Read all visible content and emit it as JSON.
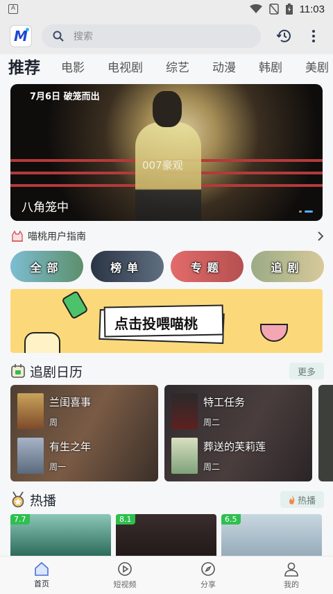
{
  "status_bar": {
    "time": "11:03"
  },
  "header": {
    "logo_letter": "M",
    "search_placeholder": "搜索"
  },
  "tabs": [
    "推荐",
    "电影",
    "电视剧",
    "综艺",
    "动漫",
    "韩剧",
    "美剧"
  ],
  "banner": {
    "date_line": "7月6日  破笼而出",
    "watermark": "007豪观",
    "title": "八角笼中",
    "slide_count": 2,
    "active_slide": 2
  },
  "guide": {
    "label": "喵桃用户指南"
  },
  "category_pills": [
    "全部",
    "榜单",
    "专题",
    "追剧"
  ],
  "promo": {
    "text": "点击投喂喵桃"
  },
  "calendar_section": {
    "title": "追剧日历",
    "more_label": "更多",
    "cards": [
      {
        "items": [
          {
            "name": "兰闺喜事",
            "day": "周"
          },
          {
            "name": "有生之年",
            "day": "周一"
          }
        ]
      },
      {
        "items": [
          {
            "name": "特工任务",
            "day": "周二"
          },
          {
            "name": "葬送的芙莉莲",
            "day": "周二"
          }
        ]
      }
    ]
  },
  "hot_section": {
    "title": "热播",
    "badge_label": "热播",
    "cards": [
      {
        "score": "7.7"
      },
      {
        "score": "8.1"
      },
      {
        "score": "6.5"
      }
    ]
  },
  "bottom_nav": [
    {
      "label": "首页",
      "icon": "home-icon",
      "active": true
    },
    {
      "label": "短视频",
      "icon": "play-circle-icon",
      "active": false
    },
    {
      "label": "分享",
      "icon": "compass-icon",
      "active": false
    },
    {
      "label": "我的",
      "icon": "user-icon",
      "active": false
    }
  ]
}
